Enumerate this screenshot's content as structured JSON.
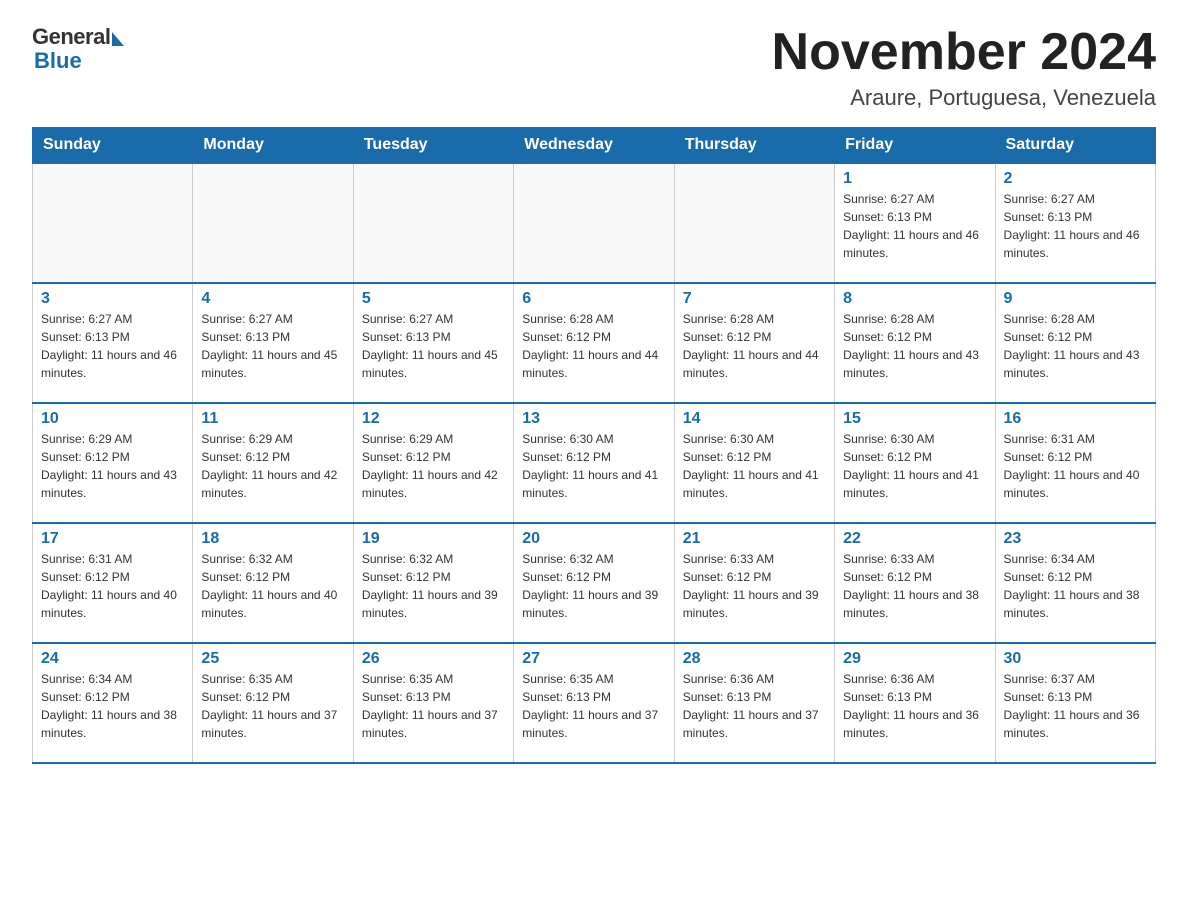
{
  "header": {
    "logo_general": "General",
    "logo_blue": "Blue",
    "month_title": "November 2024",
    "location": "Araure, Portuguesa, Venezuela"
  },
  "weekdays": [
    "Sunday",
    "Monday",
    "Tuesday",
    "Wednesday",
    "Thursday",
    "Friday",
    "Saturday"
  ],
  "weeks": [
    [
      {
        "day": "",
        "info": ""
      },
      {
        "day": "",
        "info": ""
      },
      {
        "day": "",
        "info": ""
      },
      {
        "day": "",
        "info": ""
      },
      {
        "day": "",
        "info": ""
      },
      {
        "day": "1",
        "info": "Sunrise: 6:27 AM\nSunset: 6:13 PM\nDaylight: 11 hours and 46 minutes."
      },
      {
        "day": "2",
        "info": "Sunrise: 6:27 AM\nSunset: 6:13 PM\nDaylight: 11 hours and 46 minutes."
      }
    ],
    [
      {
        "day": "3",
        "info": "Sunrise: 6:27 AM\nSunset: 6:13 PM\nDaylight: 11 hours and 46 minutes."
      },
      {
        "day": "4",
        "info": "Sunrise: 6:27 AM\nSunset: 6:13 PM\nDaylight: 11 hours and 45 minutes."
      },
      {
        "day": "5",
        "info": "Sunrise: 6:27 AM\nSunset: 6:13 PM\nDaylight: 11 hours and 45 minutes."
      },
      {
        "day": "6",
        "info": "Sunrise: 6:28 AM\nSunset: 6:12 PM\nDaylight: 11 hours and 44 minutes."
      },
      {
        "day": "7",
        "info": "Sunrise: 6:28 AM\nSunset: 6:12 PM\nDaylight: 11 hours and 44 minutes."
      },
      {
        "day": "8",
        "info": "Sunrise: 6:28 AM\nSunset: 6:12 PM\nDaylight: 11 hours and 43 minutes."
      },
      {
        "day": "9",
        "info": "Sunrise: 6:28 AM\nSunset: 6:12 PM\nDaylight: 11 hours and 43 minutes."
      }
    ],
    [
      {
        "day": "10",
        "info": "Sunrise: 6:29 AM\nSunset: 6:12 PM\nDaylight: 11 hours and 43 minutes."
      },
      {
        "day": "11",
        "info": "Sunrise: 6:29 AM\nSunset: 6:12 PM\nDaylight: 11 hours and 42 minutes."
      },
      {
        "day": "12",
        "info": "Sunrise: 6:29 AM\nSunset: 6:12 PM\nDaylight: 11 hours and 42 minutes."
      },
      {
        "day": "13",
        "info": "Sunrise: 6:30 AM\nSunset: 6:12 PM\nDaylight: 11 hours and 41 minutes."
      },
      {
        "day": "14",
        "info": "Sunrise: 6:30 AM\nSunset: 6:12 PM\nDaylight: 11 hours and 41 minutes."
      },
      {
        "day": "15",
        "info": "Sunrise: 6:30 AM\nSunset: 6:12 PM\nDaylight: 11 hours and 41 minutes."
      },
      {
        "day": "16",
        "info": "Sunrise: 6:31 AM\nSunset: 6:12 PM\nDaylight: 11 hours and 40 minutes."
      }
    ],
    [
      {
        "day": "17",
        "info": "Sunrise: 6:31 AM\nSunset: 6:12 PM\nDaylight: 11 hours and 40 minutes."
      },
      {
        "day": "18",
        "info": "Sunrise: 6:32 AM\nSunset: 6:12 PM\nDaylight: 11 hours and 40 minutes."
      },
      {
        "day": "19",
        "info": "Sunrise: 6:32 AM\nSunset: 6:12 PM\nDaylight: 11 hours and 39 minutes."
      },
      {
        "day": "20",
        "info": "Sunrise: 6:32 AM\nSunset: 6:12 PM\nDaylight: 11 hours and 39 minutes."
      },
      {
        "day": "21",
        "info": "Sunrise: 6:33 AM\nSunset: 6:12 PM\nDaylight: 11 hours and 39 minutes."
      },
      {
        "day": "22",
        "info": "Sunrise: 6:33 AM\nSunset: 6:12 PM\nDaylight: 11 hours and 38 minutes."
      },
      {
        "day": "23",
        "info": "Sunrise: 6:34 AM\nSunset: 6:12 PM\nDaylight: 11 hours and 38 minutes."
      }
    ],
    [
      {
        "day": "24",
        "info": "Sunrise: 6:34 AM\nSunset: 6:12 PM\nDaylight: 11 hours and 38 minutes."
      },
      {
        "day": "25",
        "info": "Sunrise: 6:35 AM\nSunset: 6:12 PM\nDaylight: 11 hours and 37 minutes."
      },
      {
        "day": "26",
        "info": "Sunrise: 6:35 AM\nSunset: 6:13 PM\nDaylight: 11 hours and 37 minutes."
      },
      {
        "day": "27",
        "info": "Sunrise: 6:35 AM\nSunset: 6:13 PM\nDaylight: 11 hours and 37 minutes."
      },
      {
        "day": "28",
        "info": "Sunrise: 6:36 AM\nSunset: 6:13 PM\nDaylight: 11 hours and 37 minutes."
      },
      {
        "day": "29",
        "info": "Sunrise: 6:36 AM\nSunset: 6:13 PM\nDaylight: 11 hours and 36 minutes."
      },
      {
        "day": "30",
        "info": "Sunrise: 6:37 AM\nSunset: 6:13 PM\nDaylight: 11 hours and 36 minutes."
      }
    ]
  ]
}
